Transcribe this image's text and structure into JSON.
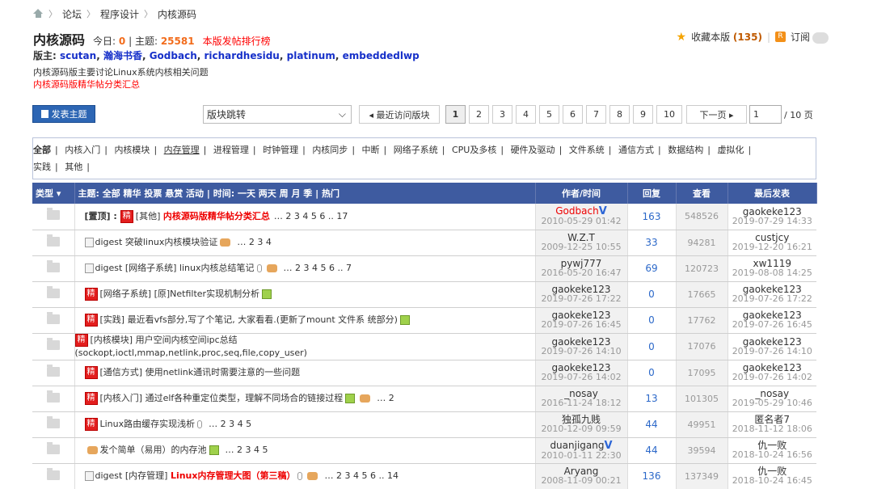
{
  "breadcrumb": {
    "items": [
      "论坛",
      "程序设计",
      "内核源码"
    ]
  },
  "forum": {
    "title": "内核源码",
    "today_label": "今日:",
    "today_count": "0",
    "sep": "|",
    "threads_label": "主题:",
    "threads_count": "25581",
    "rank_link": "本版发帖排行榜",
    "fav_label": "收藏本版",
    "fav_count": "(135)",
    "subscribe": "订阅",
    "rss_glyph": "R",
    "moderators_label": "版主:",
    "moderators": [
      "scutan",
      "瀚海书香",
      "Godbach",
      "richardhesidu",
      "platinum",
      "embeddedlwp"
    ],
    "description": "内核源码版主要讨论Linux系统内核相关问题",
    "digest_link": "内核源码版精华帖分类汇总"
  },
  "toolbar": {
    "post_button": "发表主题",
    "jump_select": "版块跳转",
    "jump_arrow": "⌵",
    "recent": "◂ 最近访问版块",
    "pages": [
      "1",
      "2",
      "3",
      "4",
      "5",
      "6",
      "7",
      "8",
      "9",
      "10"
    ],
    "current_page": "1",
    "next": "下一页 ▸",
    "page_input": "1",
    "total": "/ 10 页"
  },
  "categories": [
    "全部",
    "内核入门",
    "内核模块",
    "内存管理",
    "进程管理",
    "时钟管理",
    "内核同步",
    "中断",
    "网络子系统",
    "CPU及多核",
    "硬件及驱动",
    "文件系统",
    "通信方式",
    "数据结构",
    "虚拟化",
    "实践",
    "其他"
  ],
  "table": {
    "headers": {
      "type": "类型 ▾",
      "topic": "主题: 全部 精华 投票 悬赏 活动 | 时间: 一天 两天 周 月 季 | 热门",
      "author": "作者/时间",
      "replies": "回复",
      "views": "查看",
      "last": "最后发表"
    },
    "jing_label": "精",
    "rows": [
      {
        "prefix": "[置顶] :",
        "tag": "[其他]",
        "title": "内核源码版精华帖分类汇总",
        "pages": "… 2 3 4 5 6 .. 17",
        "author": "Godbach",
        "vip": "V",
        "date": "2010-05-29 01:42",
        "replies": "163",
        "views": "548526",
        "last_user": "gaokeke123",
        "last_date": "2019-07-29 14:33"
      },
      {
        "prefix": "digest",
        "tag": "",
        "title": "突破linux内核模块验证",
        "pages": "… 2 3 4",
        "author": "W.Z.T",
        "vip": "",
        "date": "2009-12-25 10:55",
        "replies": "33",
        "views": "94281",
        "last_user": "custjcy",
        "last_date": "2019-12-20 16:21"
      },
      {
        "prefix": "digest",
        "tag": "[网络子系统]",
        "title": "linux内核总结笔记",
        "pages": "… 2 3 4 5 6 .. 7",
        "author": "pywj777",
        "vip": "",
        "date": "2016-05-20 16:47",
        "replies": "69",
        "views": "120723",
        "last_user": "xw1119",
        "last_date": "2019-08-08 14:25"
      },
      {
        "prefix": "",
        "tag": "[网络子系统]",
        "title": "[原]Netfilter实现机制分析",
        "pages": "",
        "author": "gaokeke123",
        "vip": "",
        "date": "2019-07-26 17:22",
        "replies": "0",
        "views": "17665",
        "last_user": "gaokeke123",
        "last_date": "2019-07-26 17:22"
      },
      {
        "prefix": "",
        "tag": "[实践]",
        "title": "最近看vfs部分,写了个笔记, 大家看看.(更新了mount 文件系 统部分)",
        "pages": "",
        "author": "gaokeke123",
        "vip": "",
        "date": "2019-07-26 16:45",
        "replies": "0",
        "views": "17762",
        "last_user": "gaokeke123",
        "last_date": "2019-07-26 16:45"
      },
      {
        "prefix": "",
        "tag": "[内核模块]",
        "title": "用户空间内核空间ipc总结",
        "title2": "(sockopt,ioctl,mmap,netlink,proc,seq,file,copy_user)",
        "pages": "",
        "author": "gaokeke123",
        "vip": "",
        "date": "2019-07-26 14:10",
        "replies": "0",
        "views": "17076",
        "last_user": "gaokeke123",
        "last_date": "2019-07-26 14:10"
      },
      {
        "prefix": "",
        "tag": "[通信方式]",
        "title": "使用netlink通讯时需要注意的一些问题",
        "pages": "",
        "author": "gaokeke123",
        "vip": "",
        "date": "2019-07-26 14:02",
        "replies": "0",
        "views": "17095",
        "last_user": "gaokeke123",
        "last_date": "2019-07-26 14:02"
      },
      {
        "prefix": "",
        "tag": "[内核入门]",
        "title": "通过elf各种重定位类型，理解不同场合的链接过程",
        "pages": "… 2",
        "author": "_nosay",
        "vip": "",
        "date": "2016-11-24 18:12",
        "replies": "13",
        "views": "101305",
        "last_user": "_nosay",
        "last_date": "2019-05-29 10:46"
      },
      {
        "prefix": "",
        "tag": "",
        "title": "Linux路由缓存实现浅析",
        "pages": "… 2 3 4 5",
        "author": "独孤九贱",
        "vip": "",
        "date": "2010-12-09 09:59",
        "replies": "44",
        "views": "49951",
        "last_user": "匿名者7",
        "last_date": "2018-11-12 18:06"
      },
      {
        "prefix": "",
        "tag": "",
        "title": "发个简单（易用）的内存池",
        "pages": "… 2 3 4 5",
        "author": "duanjigang",
        "vip": "V",
        "date": "2010-01-11 22:30",
        "replies": "44",
        "views": "39594",
        "last_user": "仇一败",
        "last_date": "2018-10-24 16:56"
      },
      {
        "prefix": "digest",
        "tag": "[内存管理]",
        "title": "Linux内存管理大图（第三稿）",
        "pages": "… 2 3 4 5 6 .. 14",
        "author": "Aryang",
        "vip": "",
        "date": "2008-11-09 00:21",
        "replies": "136",
        "views": "137349",
        "last_user": "仇一败",
        "last_date": "2018-10-24 16:45"
      }
    ]
  }
}
